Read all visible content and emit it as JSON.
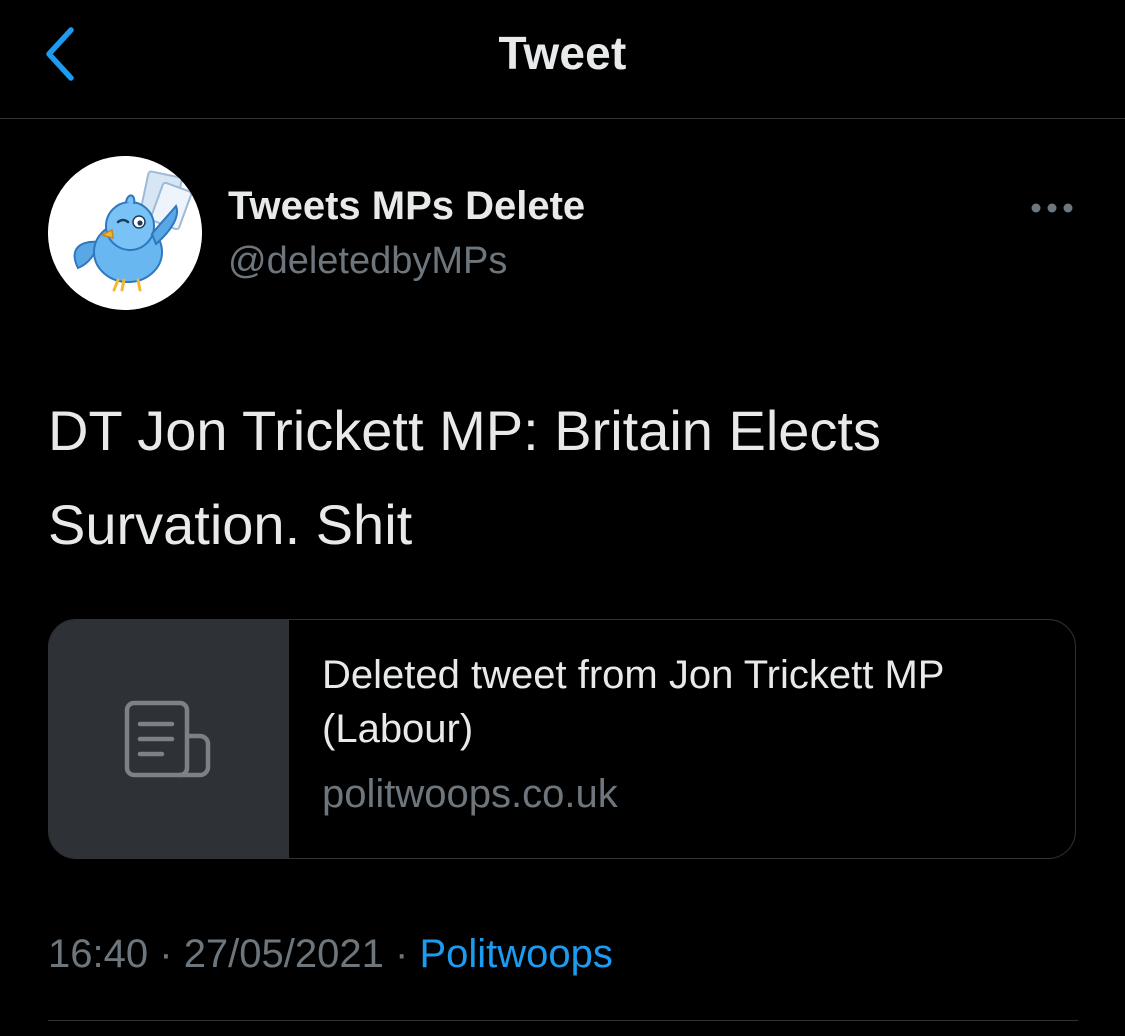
{
  "nav": {
    "title": "Tweet",
    "back_icon": "chevron-left-icon"
  },
  "tweet": {
    "author": {
      "display_name": "Tweets MPs Delete",
      "handle": "@deletedbyMPs",
      "avatar_icon": "bird-avatar-icon"
    },
    "more_icon": "more-dots-icon",
    "text": "DT Jon Trickett MP: Britain Elects Survation. Shit",
    "link_card": {
      "thumb_icon": "article-icon",
      "title": "Deleted tweet from Jon Trickett MP (Labour)",
      "domain": "politwoops.co.uk"
    },
    "meta": {
      "time": "16:40",
      "separator": "·",
      "date": "27/05/2021",
      "source": "Politwoops"
    }
  },
  "colors": {
    "background": "#000000",
    "text_primary": "#e7e9ea",
    "text_secondary": "#6e767d",
    "accent": "#1d9bf0",
    "divider": "#2f3336",
    "card_thumb": "#2e3136"
  }
}
